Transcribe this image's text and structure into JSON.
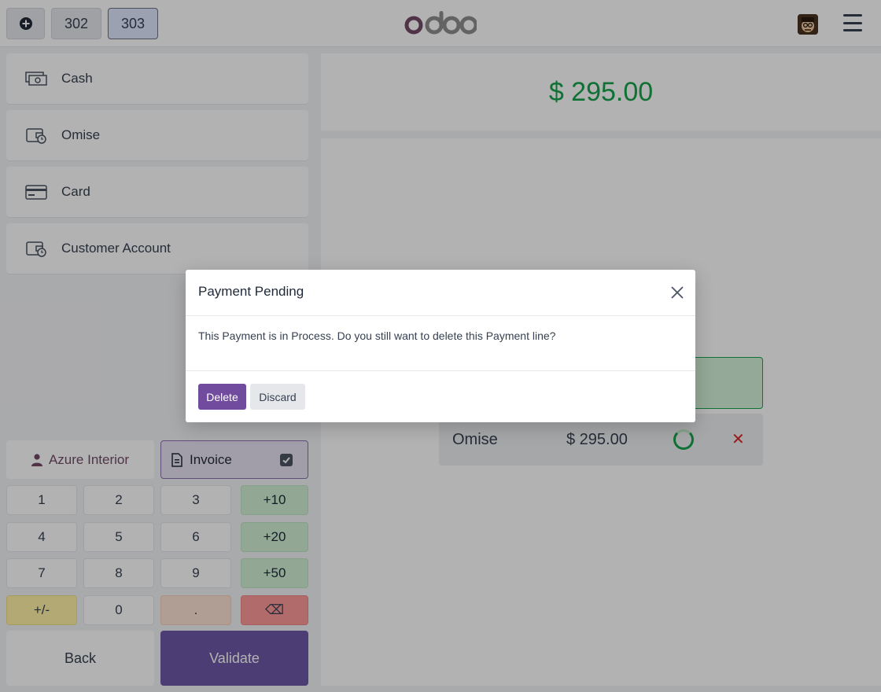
{
  "topbar": {
    "new_order_icon": "plus-circle-icon",
    "orders": [
      "302",
      "303"
    ],
    "active_order": "303",
    "logo": "odoo",
    "menu_icon": "hamburger-icon"
  },
  "payment_methods": [
    {
      "label": "Cash",
      "icon": "cash-icon"
    },
    {
      "label": "Omise",
      "icon": "wallet-clock-icon"
    },
    {
      "label": "Card",
      "icon": "credit-card-icon"
    },
    {
      "label": "Customer Account",
      "icon": "wallet-clock-icon"
    }
  ],
  "partner": {
    "label": "Azure Interior",
    "icon": "user-icon"
  },
  "invoice": {
    "label": "Invoice",
    "checked": true
  },
  "numpad": {
    "keys": [
      "1",
      "2",
      "3",
      "+10",
      "4",
      "5",
      "6",
      "+20",
      "7",
      "8",
      "9",
      "+50",
      "+/-",
      "0",
      ".",
      "⌫"
    ]
  },
  "actions": {
    "back": "Back",
    "validate": "Validate"
  },
  "total": {
    "amount": "$ 295.00"
  },
  "payment_line": {
    "method": "Omise",
    "amount": "$ 295.00",
    "status_icon": "spinner-icon",
    "delete_icon": "close-icon"
  },
  "modal": {
    "title": "Payment Pending",
    "body": "This Payment is in Process. Do you still want to delete this Payment line?",
    "delete_label": "Delete",
    "discard_label": "Discard"
  },
  "colors": {
    "brand": "#714b67",
    "total": "#16a34a",
    "validate": "#6f58a8",
    "delete": "#714b9e"
  }
}
